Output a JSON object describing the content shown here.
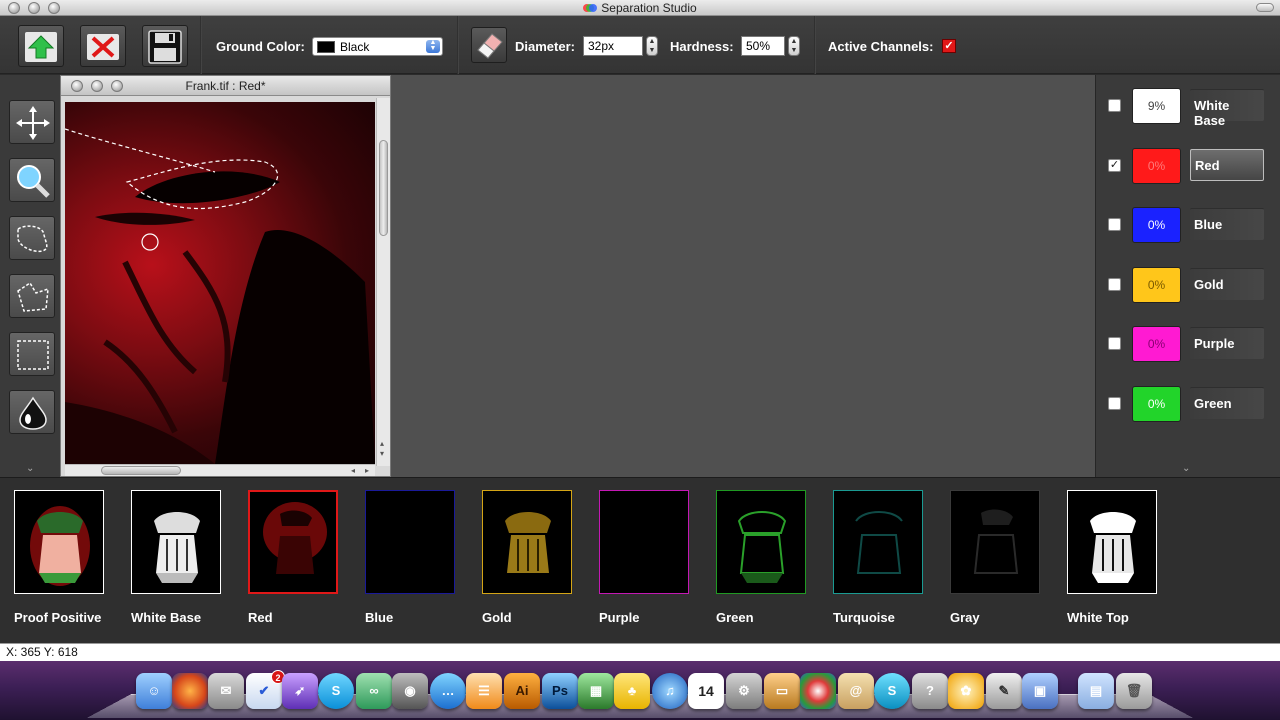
{
  "window": {
    "title": "Separation Studio"
  },
  "toolbar": {
    "ground_color_label": "Ground Color:",
    "ground_color_value": "Black",
    "diameter_label": "Diameter:",
    "diameter_value": "32px",
    "hardness_label": "Hardness:",
    "hardness_value": "50%",
    "active_channels_label": "Active Channels:",
    "active_channels_checked": true
  },
  "document": {
    "title": "Frank.tif : Red*"
  },
  "channels": [
    {
      "name": "White Base",
      "percent": "9%",
      "color": "#ffffff",
      "text_color": "#444444",
      "checked": false,
      "selected": false
    },
    {
      "name": "Red",
      "percent": "0%",
      "color": "#ff1a1a",
      "text_color": "#ff7a7a",
      "checked": true,
      "selected": true
    },
    {
      "name": "Blue",
      "percent": "0%",
      "color": "#1a22ff",
      "text_color": "#ffffff",
      "checked": false,
      "selected": false
    },
    {
      "name": "Gold",
      "percent": "0%",
      "color": "#ffc61a",
      "text_color": "#7a5a00",
      "checked": false,
      "selected": false
    },
    {
      "name": "Purple",
      "percent": "0%",
      "color": "#ff1ad2",
      "text_color": "#8a0072",
      "checked": false,
      "selected": false
    },
    {
      "name": "Green",
      "percent": "0%",
      "color": "#22d42a",
      "text_color": "#ffffff",
      "checked": false,
      "selected": false
    }
  ],
  "thumbnails": [
    {
      "label": "Proof Positive",
      "border": "#ffffff"
    },
    {
      "label": "White Base",
      "border": "#ffffff"
    },
    {
      "label": "Red",
      "border": "#e01818"
    },
    {
      "label": "Blue",
      "border": "#1a1a9a"
    },
    {
      "label": "Gold",
      "border": "#d4a516"
    },
    {
      "label": "Purple",
      "border": "#c418b4"
    },
    {
      "label": "Green",
      "border": "#1f9a22"
    },
    {
      "label": "Turquoise",
      "border": "#1a9a92"
    },
    {
      "label": "Gray",
      "border": "#3a3a3a"
    },
    {
      "label": "White Top",
      "border": "#ffffff"
    }
  ],
  "status": {
    "coords": "X: 365 Y: 618"
  },
  "dock": {
    "mail_badge": "2",
    "calendar_day": "14",
    "illustrator_label": "Ai",
    "photoshop_label": "Ps"
  }
}
